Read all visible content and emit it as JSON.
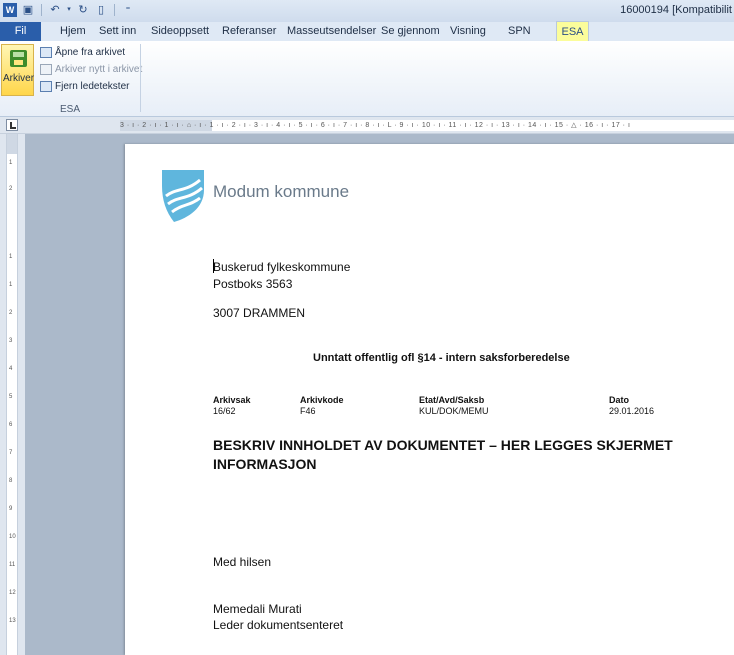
{
  "titlebar": {
    "document_title": "16000194 [Kompatibilit",
    "qat_icons": [
      "word-icon",
      "save-icon",
      "undo-icon",
      "redo-icon",
      "new-doc-icon",
      "customize-icon"
    ]
  },
  "tabs": [
    {
      "label": "Fil"
    },
    {
      "label": "Hjem"
    },
    {
      "label": "Sett inn"
    },
    {
      "label": "Sideoppsett"
    },
    {
      "label": "Referanser"
    },
    {
      "label": "Masseutsendelser"
    },
    {
      "label": "Se gjennom"
    },
    {
      "label": "Visning"
    },
    {
      "label": "SPN"
    },
    {
      "label": "ESA"
    }
  ],
  "ribbon": {
    "archive_button": "Arkiver",
    "open_from_archive": "Åpne fra arkivet",
    "archive_new": "Arkiver nytt i arkivet",
    "remove_guides": "Fjern ledetekster",
    "group_label": "ESA"
  },
  "ruler": {
    "horizontal_text": "3 · ı · 2 · ı · 1 · ı · ⌂ · ı · 1 · ı · 2 · ı · 3 · ı · 4 · ı · 5 · ı · 6 · ı · 7 · ı · 8 · ı · L · 9 · ı · 10 · ı · 11 · ı · 12 · ı · 13 · ı · 14 · ı · 15 · △ · 16 · ı · 17 · ı",
    "vertical_ticks": [
      "1",
      "2",
      "1",
      "1",
      "2",
      "3",
      "4",
      "5",
      "6",
      "7",
      "8",
      "9",
      "10",
      "11",
      "12",
      "13"
    ]
  },
  "document": {
    "org_name": "Modum kommune",
    "recipient": {
      "name": "Buskerud fylkeskommune",
      "address": "Postboks 3563",
      "postal": "3007 DRAMMEN"
    },
    "classification": "Unntatt offentlig ofl §14 - intern saksforberedelse",
    "meta_headers": {
      "arkivsak": "Arkivsak",
      "arkivkode": "Arkivkode",
      "etat": "Etat/Avd/Saksb",
      "dato": "Dato"
    },
    "meta_values": {
      "arkivsak": "16/62",
      "arkivkode": "F46",
      "etat": "KUL/DOK/MEMU",
      "dato": "29.01.2016"
    },
    "heading_line1": "BESKRIV INNHOLDET AV DOKUMENTET – HER LEGGES SKJERMET",
    "heading_line2": "INFORMASJON",
    "greeting": "Med hilsen",
    "signer_name": "Memedali Murati",
    "signer_title": "Leder dokumentsenteret"
  },
  "colors": {
    "file_tab": "#2a5eaa",
    "esa_tab": "#fbfd9b",
    "logo_blue": "#5fb6dd"
  }
}
